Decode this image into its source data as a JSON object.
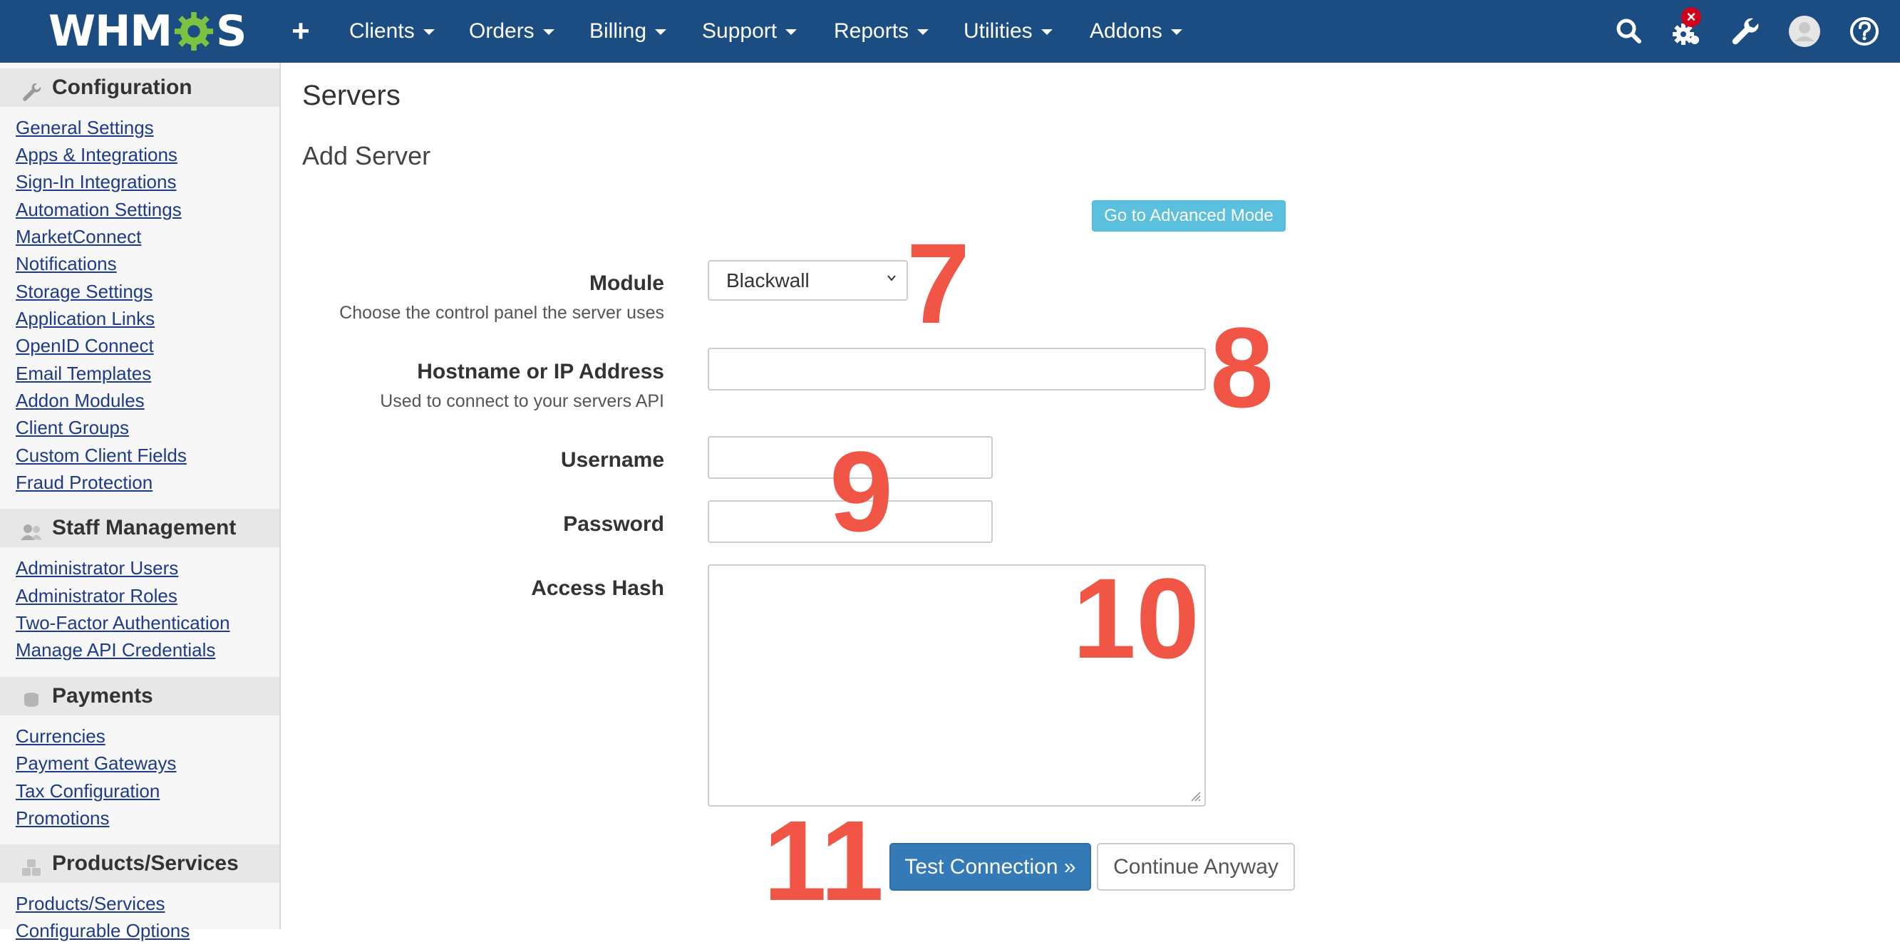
{
  "topbar": {
    "logo_left": "WHM",
    "logo_right": "S",
    "add_symbol": "+",
    "menu": [
      {
        "label": "Clients"
      },
      {
        "label": "Orders"
      },
      {
        "label": "Billing"
      },
      {
        "label": "Support"
      },
      {
        "label": "Reports"
      },
      {
        "label": "Utilities"
      },
      {
        "label": "Addons"
      }
    ],
    "notification_badge": "×",
    "icons": [
      "search-icon",
      "gear-icon",
      "wrench-icon",
      "avatar",
      "help-icon"
    ],
    "colors": {
      "bar": "#1b4d82",
      "logo_gear": "#7cc242",
      "badge": "#d0021b"
    }
  },
  "sidebar": {
    "sections": [
      {
        "title": "Configuration",
        "icon": "wrench-icon",
        "links": [
          "General Settings",
          "Apps & Integrations",
          "Sign-In Integrations",
          "Automation Settings",
          "MarketConnect",
          "Notifications",
          "Storage Settings",
          "Application Links",
          "OpenID Connect",
          "Email Templates",
          "Addon Modules",
          "Client Groups",
          "Custom Client Fields",
          "Fraud Protection"
        ]
      },
      {
        "title": "Staff Management",
        "icon": "users-icon",
        "links": [
          "Administrator Users",
          "Administrator Roles",
          "Two-Factor Authentication",
          "Manage API Credentials"
        ]
      },
      {
        "title": "Payments",
        "icon": "coins-icon",
        "links": [
          "Currencies",
          "Payment Gateways",
          "Tax Configuration",
          "Promotions"
        ]
      },
      {
        "title": "Products/Services",
        "icon": "cubes-icon",
        "links": [
          "Products/Services",
          "Configurable Options"
        ]
      }
    ]
  },
  "main": {
    "page_title": "Servers",
    "section_title": "Add Server",
    "advanced_mode_button": "Go to Advanced Mode",
    "fields": {
      "module": {
        "label": "Module",
        "help": "Choose the control panel the server uses",
        "value": "Blackwall"
      },
      "hostname": {
        "label": "Hostname or IP Address",
        "help": "Used to connect to your servers API",
        "value": ""
      },
      "username": {
        "label": "Username",
        "value": ""
      },
      "password": {
        "label": "Password",
        "value": ""
      },
      "access_hash": {
        "label": "Access Hash",
        "value": ""
      }
    },
    "test_button": "Test Connection »",
    "continue_button": "Continue Anyway",
    "annotations": [
      "7",
      "8",
      "9",
      "10",
      "11"
    ],
    "annotation_color": "#f05545"
  }
}
